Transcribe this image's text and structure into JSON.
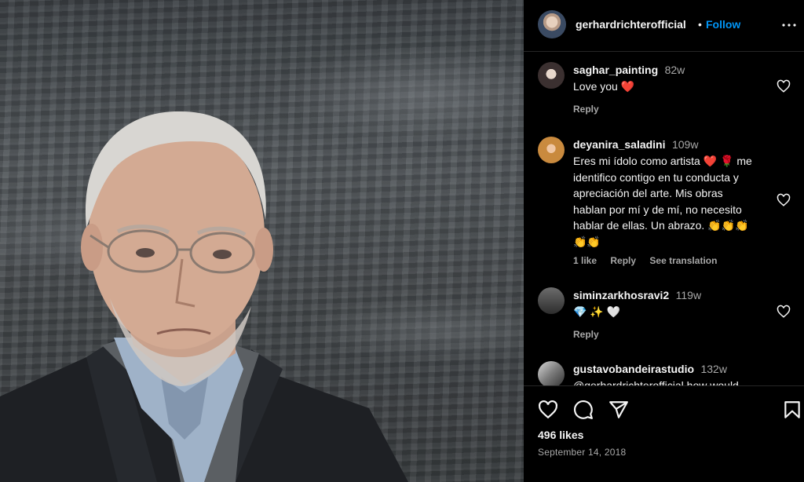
{
  "post": {
    "author": "gerhardrichterofficial",
    "separator": "•",
    "follow_label": "Follow",
    "likes": "496 likes",
    "date": "September 14, 2018"
  },
  "comments": [
    {
      "username": "saghar_painting",
      "time": "82w",
      "text": "Love you ❤️",
      "reply_label": "Reply"
    },
    {
      "username": "deyanira_saladini",
      "time": "109w",
      "text_lines": [
        "Eres mi ídolo como artista ❤️ 🌹 me",
        "identifico contigo en tu conducta y",
        "apreciación del arte. Mis obras",
        "hablan por mí y de mí, no necesito",
        "hablar de ellas. Un abrazo. 👏👏👏",
        "👏👏"
      ],
      "likes_label": "1 like",
      "reply_label": "Reply",
      "translate_label": "See translation"
    },
    {
      "username": "siminzarkhosravi2",
      "time": "119w",
      "text": "💎 ✨ 🤍",
      "reply_label": "Reply"
    },
    {
      "username": "gustavobandeirastudio",
      "time": "132w",
      "text": "@gerhardrichterofficial how would"
    }
  ],
  "icons": {
    "more": "more-options-icon",
    "like": "heart-icon",
    "comment": "comment-icon",
    "share": "share-icon",
    "save": "bookmark-icon"
  },
  "colors": {
    "link": "#0095f6",
    "heart": "#ed4956",
    "muted": "#a8a8a8",
    "background": "#000000"
  }
}
